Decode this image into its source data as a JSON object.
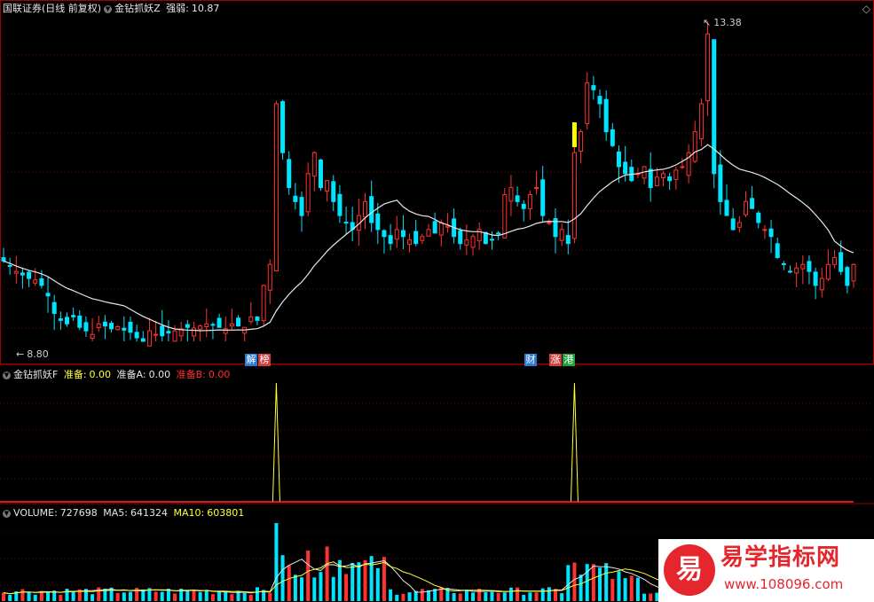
{
  "header": {
    "security_name": "国联证券(日线 前复权)",
    "indicator": "金钻抓妖Z",
    "strength_label": "强弱:",
    "strength_value": "10.87"
  },
  "main_chart": {
    "high_label": "13.38",
    "low_label": "8.80",
    "markers": [
      {
        "text": "解",
        "color": "#2a7bd6"
      },
      {
        "text": "榜",
        "color": "#d23f3f"
      },
      {
        "text": "财",
        "color": "#2a7bd6"
      },
      {
        "text": "涨",
        "color": "#d23f3f"
      },
      {
        "text": "港",
        "color": "#22a03c"
      }
    ],
    "colors": {
      "up": "#ff3232",
      "down": "#00e5ff",
      "ma": "#e8e8e8",
      "grid": "#7a0000",
      "frame": "#a00000"
    }
  },
  "sub_panel": {
    "title": "金钻抓妖F",
    "ready_label": "准备:",
    "ready_value": "0.00",
    "ready_a_label": "准备A:",
    "ready_a_value": "0.00",
    "ready_b_label": "准备B:",
    "ready_b_value": "0.00",
    "spikes": [
      {
        "bar": 43
      },
      {
        "bar": 90
      }
    ]
  },
  "volume_panel": {
    "title": "VOLUME:",
    "value": "727698",
    "ma5_label": "MA5:",
    "ma5_value": "641324",
    "ma10_label": "MA10:",
    "ma10_value": "603801"
  },
  "watermark": {
    "badge": "易",
    "title": "易学指标网",
    "url": "www.108096.com"
  },
  "chart_data": {
    "type": "candlestick",
    "y_range": [
      8.8,
      13.38
    ],
    "closes": [
      9.95,
      9.88,
      9.8,
      9.75,
      9.7,
      9.68,
      9.6,
      9.45,
      9.2,
      9.1,
      9.05,
      9.15,
      9.0,
      8.95,
      8.9,
      9.05,
      9.02,
      8.98,
      9.01,
      8.96,
      8.93,
      8.85,
      8.8,
      8.95,
      8.9,
      8.88,
      8.92,
      8.95,
      8.98,
      9.0,
      8.99,
      9.02,
      9.05,
      9.03,
      9.0,
      8.98,
      9.05,
      9.02,
      9.0,
      9.15,
      9.1,
      9.6,
      9.9,
      12.2,
      11.5,
      11.0,
      10.8,
      10.6,
      11.2,
      11.5,
      11.0,
      11.1,
      10.8,
      10.6,
      10.5,
      10.4,
      10.6,
      10.8,
      10.5,
      10.4,
      10.3,
      10.2,
      10.4,
      10.3,
      10.25,
      10.2,
      10.3,
      10.4,
      10.35,
      10.5,
      10.45,
      10.3,
      10.2,
      10.25,
      10.3,
      10.4,
      10.2,
      10.25,
      10.35,
      10.9,
      11.0,
      10.8,
      10.7,
      10.9,
      11.0,
      10.6,
      10.5,
      10.3,
      10.4,
      10.2,
      11.5,
      11.8,
      12.5,
      12.4,
      12.2,
      11.8,
      11.6,
      11.3,
      11.2,
      11.1,
      11.2,
      11.3,
      11.0,
      11.15,
      11.2,
      11.1,
      11.25,
      11.3,
      11.5,
      11.8,
      12.2,
      13.2,
      11.2,
      10.8,
      10.6,
      10.4,
      10.5,
      10.8,
      10.7,
      10.5,
      10.4,
      10.3,
      10.0,
      9.9,
      9.8,
      9.85,
      9.9,
      9.8,
      9.6,
      9.7,
      9.9,
      10.0,
      9.8,
      9.6,
      9.9
    ],
    "ma_note": ""
  }
}
